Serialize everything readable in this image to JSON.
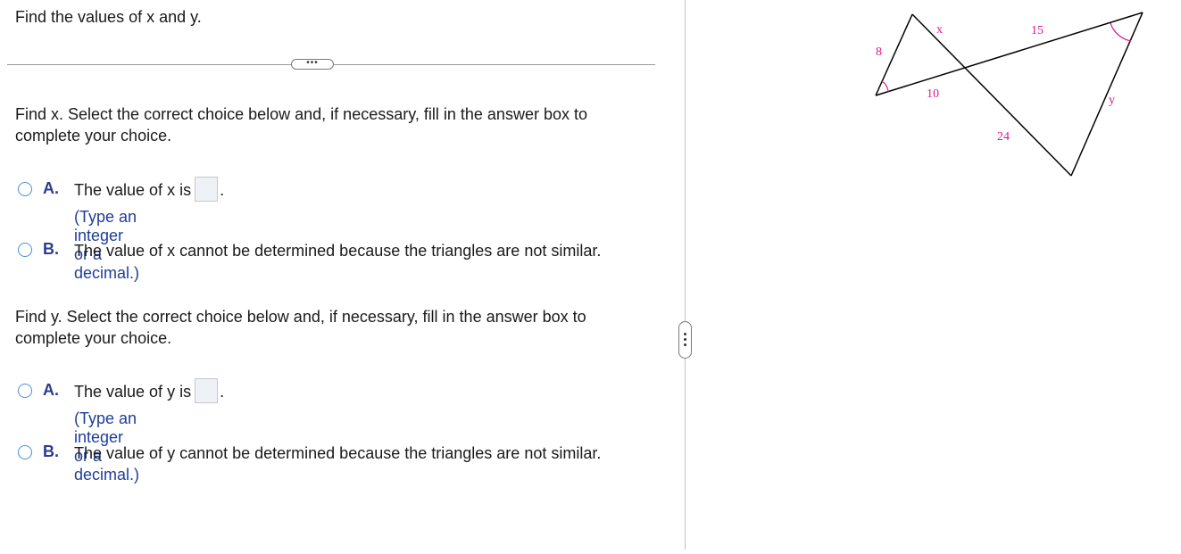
{
  "question": {
    "title": "Find the values of x and y."
  },
  "expand_horizontal_label": "•••",
  "part_x": {
    "prompt": "Find x. Select the correct choice below and, if necessary, fill in the answer box to complete your choice.",
    "option_a": {
      "letter": "A.",
      "text_before": "The value of x is",
      "text_after": ".",
      "hint": "(Type an integer or a decimal.)"
    },
    "option_b": {
      "letter": "B.",
      "text": "The value of x cannot be determined because the triangles are not similar."
    }
  },
  "part_y": {
    "prompt": "Find y. Select the correct choice below and, if necessary, fill in the answer box to complete your choice.",
    "option_a": {
      "letter": "A.",
      "text_before": "The value of y is",
      "text_after": ".",
      "hint": "(Type an integer or a decimal.)"
    },
    "option_b": {
      "letter": "B.",
      "text": "The value of y cannot be determined because the triangles are not similar."
    }
  },
  "figure": {
    "labels": {
      "side_8": "8",
      "side_x": "x",
      "side_10": "10",
      "side_15": "15",
      "side_24": "24",
      "side_y": "y"
    },
    "label_color": "#e0188c",
    "angle_mark_color": "#e0188c",
    "line_color": "#000000"
  },
  "colors": {
    "accent": "#2b3d8f",
    "radio": "#4a8fd6",
    "hint": "#1f3d99",
    "divider": "#c9b8d9"
  }
}
